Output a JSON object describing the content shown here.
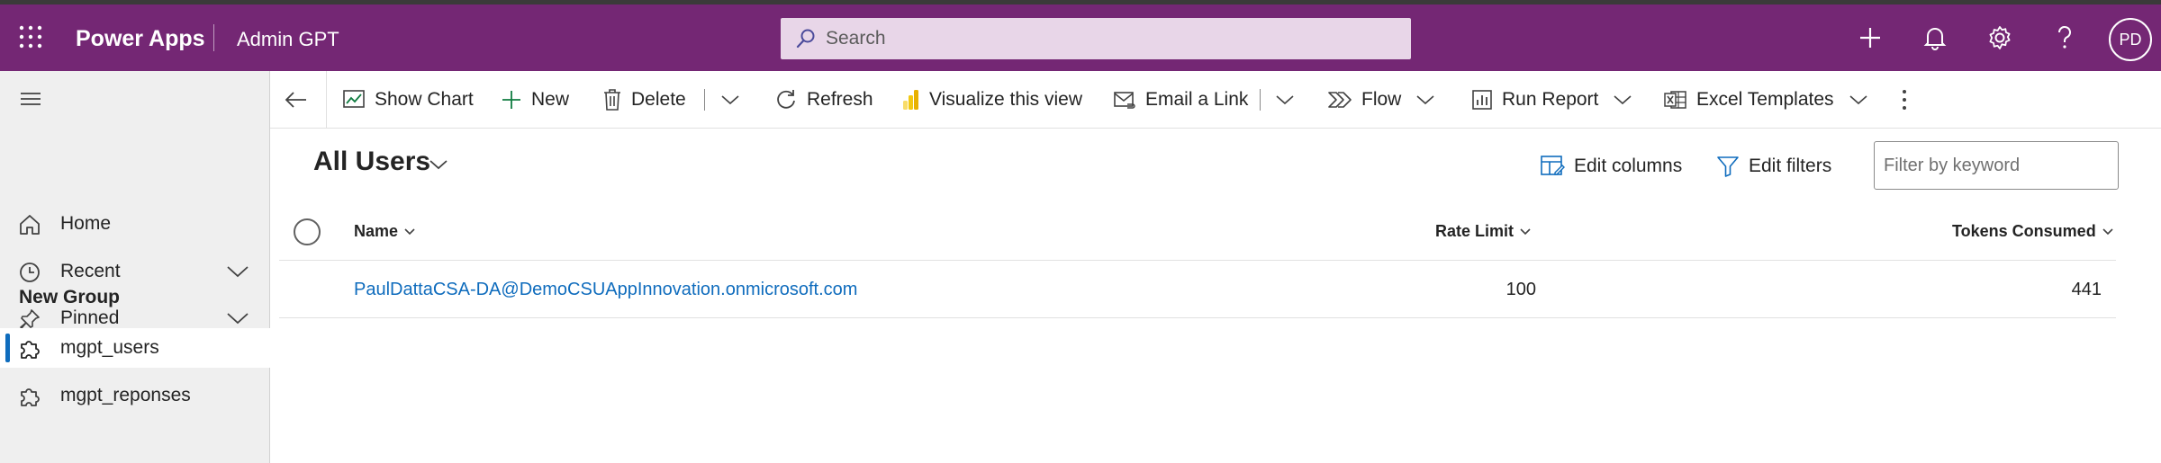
{
  "header": {
    "app_name": "Power Apps",
    "environment": "Admin GPT",
    "search_placeholder": "Search",
    "avatar_initials": "PD",
    "icons": [
      "waffle-icon",
      "search-icon",
      "add-icon",
      "bell-icon",
      "gear-icon",
      "help-icon"
    ]
  },
  "sidebar": {
    "items": [
      {
        "label": "Home",
        "icon": "home-icon"
      },
      {
        "label": "Recent",
        "icon": "clock-icon"
      },
      {
        "label": "Pinned",
        "icon": "pin-icon"
      }
    ],
    "group_title": "New Group",
    "group_items": [
      {
        "label": "mgpt_users",
        "icon": "puzzle-icon",
        "active": true
      },
      {
        "label": "mgpt_reponses",
        "icon": "puzzle-icon",
        "active": false
      }
    ]
  },
  "commands": {
    "show_chart": "Show Chart",
    "new": "New",
    "delete": "Delete",
    "refresh": "Refresh",
    "visualize": "Visualize this view",
    "email_link": "Email a Link",
    "flow": "Flow",
    "run_report": "Run Report",
    "excel_templates": "Excel Templates"
  },
  "view": {
    "title": "All Users",
    "edit_columns": "Edit columns",
    "edit_filters": "Edit filters",
    "filter_placeholder": "Filter by keyword"
  },
  "grid": {
    "columns": [
      "Name",
      "Rate Limit",
      "Tokens Consumed"
    ],
    "rows": [
      {
        "name": "PaulDattaCSA-DA@DemoCSUAppInnovation.onmicrosoft.com",
        "rate_limit": "100",
        "tokens_consumed": "441"
      }
    ]
  },
  "colors": {
    "app_bar": "#742774",
    "search_bg": "#e8d6e8",
    "accent": "#0f6cbd",
    "sidebar_bg": "#efefef"
  }
}
